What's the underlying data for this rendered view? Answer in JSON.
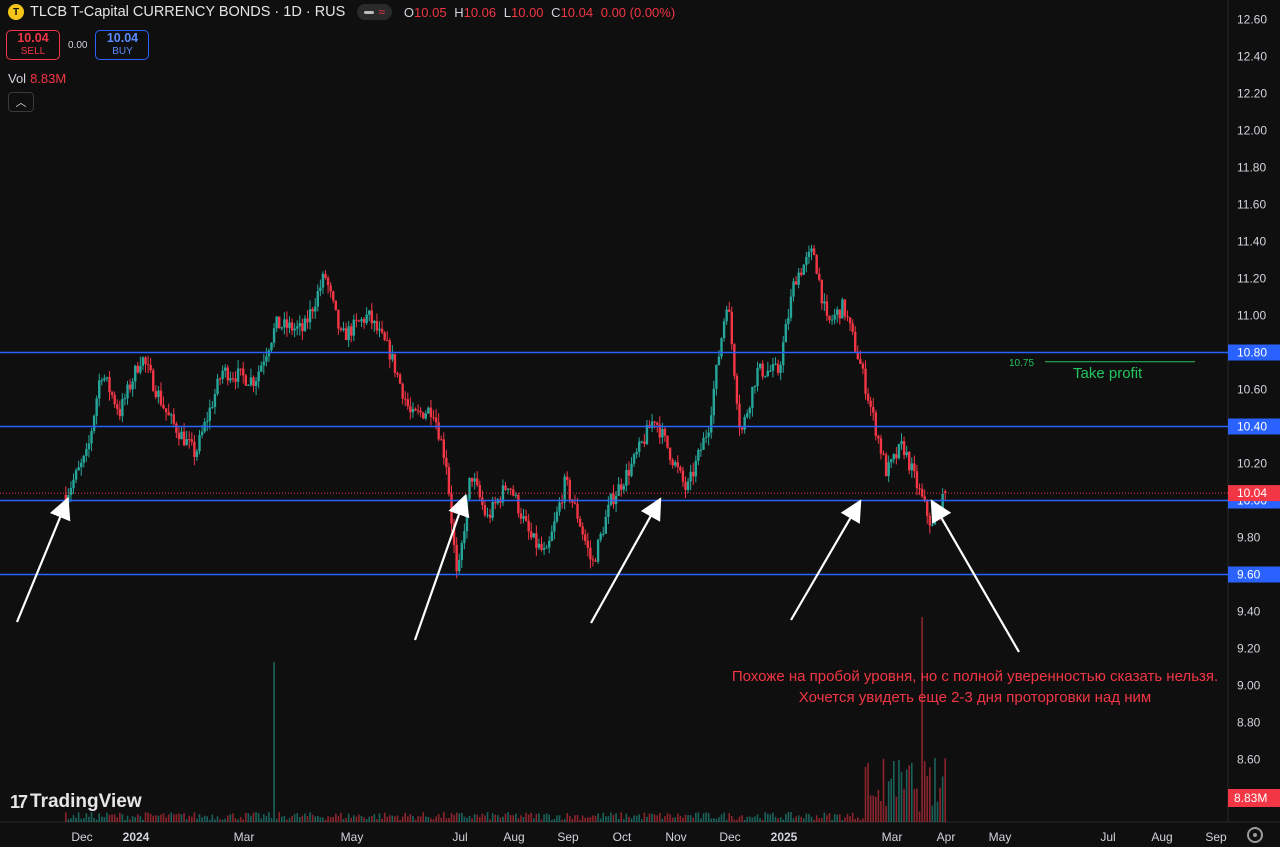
{
  "header": {
    "symbol_icon": "T",
    "title": "TLCB T-Capital CURRENCY BONDS · 1D · RUS",
    "o_label": "O",
    "o": "10.05",
    "h_label": "H",
    "h": "10.06",
    "l_label": "L",
    "l": "10.00",
    "c_label": "C",
    "c": "10.04",
    "change": "0.00 (0.00%)"
  },
  "trade": {
    "sell_price": "10.04",
    "sell_label": "SELL",
    "spread": "0.00",
    "buy_price": "10.04",
    "buy_label": "BUY"
  },
  "volume": {
    "label": "Vol",
    "value": "8.83M"
  },
  "logo_text": "TradingView",
  "colors": {
    "up": "#26a69a",
    "down": "#f23645",
    "level": "#2962ff",
    "target": "#22c55e",
    "bg": "#0f0f0f"
  },
  "chart_data": {
    "type": "candlestick",
    "ylim": [
      9.0,
      12.7
    ],
    "y_ticks": [
      "12.60",
      "12.40",
      "12.20",
      "12.00",
      "11.80",
      "11.60",
      "11.40",
      "11.20",
      "11.00",
      "10.80",
      "10.60",
      "10.40",
      "10.20",
      "10.00",
      "9.80",
      "9.60",
      "9.40",
      "9.20",
      "9.00",
      "8.80",
      "8.60"
    ],
    "x_ticks": [
      {
        "label": "Dec",
        "month": 0,
        "bold": false
      },
      {
        "label": "2024",
        "month": 1,
        "bold": true
      },
      {
        "label": "Mar",
        "month": 3,
        "bold": false
      },
      {
        "label": "May",
        "month": 5,
        "bold": false
      },
      {
        "label": "Jul",
        "month": 7,
        "bold": false
      },
      {
        "label": "Aug",
        "month": 8,
        "bold": false
      },
      {
        "label": "Sep",
        "month": 9,
        "bold": false
      },
      {
        "label": "Oct",
        "month": 10,
        "bold": false
      },
      {
        "label": "Nov",
        "month": 11,
        "bold": false
      },
      {
        "label": "Dec",
        "month": 12,
        "bold": false
      },
      {
        "label": "2025",
        "month": 13,
        "bold": true
      },
      {
        "label": "Mar",
        "month": 15,
        "bold": false
      },
      {
        "label": "Apr",
        "month": 16,
        "bold": false
      },
      {
        "label": "May",
        "month": 17,
        "bold": false
      },
      {
        "label": "Jul",
        "month": 19,
        "bold": false
      },
      {
        "label": "Aug",
        "month": 20,
        "bold": false
      },
      {
        "label": "Sep",
        "month": 21,
        "bold": false
      }
    ],
    "levels": [
      {
        "price": 10.8,
        "label": "10.80"
      },
      {
        "price": 10.4,
        "label": "10.40"
      },
      {
        "price": 10.0,
        "label": "10.00"
      },
      {
        "price": 9.6,
        "label": "9.60"
      }
    ],
    "current_price": {
      "price": 10.04,
      "label": "10.04"
    },
    "volume_label": "8.83M",
    "take_profit": {
      "price": 10.75,
      "label": "10.75",
      "text": "Take profit"
    },
    "anchors": [
      {
        "month": -0.3,
        "price": 10.03
      },
      {
        "month": 0.1,
        "price": 10.25
      },
      {
        "month": 0.35,
        "price": 10.7
      },
      {
        "month": 0.7,
        "price": 10.48
      },
      {
        "month": 1.1,
        "price": 10.78
      },
      {
        "month": 1.6,
        "price": 10.45
      },
      {
        "month": 2.1,
        "price": 10.25
      },
      {
        "month": 2.6,
        "price": 10.7
      },
      {
        "month": 3.2,
        "price": 10.65
      },
      {
        "month": 3.6,
        "price": 10.95
      },
      {
        "month": 4.1,
        "price": 10.92
      },
      {
        "month": 4.5,
        "price": 11.22
      },
      {
        "month": 4.8,
        "price": 10.88
      },
      {
        "month": 5.3,
        "price": 11.0
      },
      {
        "month": 5.7,
        "price": 10.8
      },
      {
        "month": 6.1,
        "price": 10.45
      },
      {
        "month": 6.5,
        "price": 10.5
      },
      {
        "month": 6.75,
        "price": 10.2
      },
      {
        "month": 6.95,
        "price": 9.55
      },
      {
        "month": 7.2,
        "price": 10.15
      },
      {
        "month": 7.5,
        "price": 9.9
      },
      {
        "month": 7.9,
        "price": 10.1
      },
      {
        "month": 8.3,
        "price": 9.8
      },
      {
        "month": 8.6,
        "price": 9.7
      },
      {
        "month": 8.95,
        "price": 10.1
      },
      {
        "month": 9.2,
        "price": 9.9
      },
      {
        "month": 9.45,
        "price": 9.65
      },
      {
        "month": 9.8,
        "price": 10.0
      },
      {
        "month": 10.2,
        "price": 10.2
      },
      {
        "month": 10.6,
        "price": 10.45
      },
      {
        "month": 10.9,
        "price": 10.25
      },
      {
        "month": 11.2,
        "price": 10.05
      },
      {
        "month": 11.6,
        "price": 10.4
      },
      {
        "month": 11.95,
        "price": 11.1
      },
      {
        "month": 12.2,
        "price": 10.35
      },
      {
        "month": 12.5,
        "price": 10.7
      },
      {
        "month": 12.9,
        "price": 10.7
      },
      {
        "month": 13.2,
        "price": 11.2
      },
      {
        "month": 13.55,
        "price": 11.35
      },
      {
        "month": 13.8,
        "price": 10.95
      },
      {
        "month": 14.1,
        "price": 11.05
      },
      {
        "month": 14.4,
        "price": 10.75
      },
      {
        "month": 14.65,
        "price": 10.45
      },
      {
        "month": 14.9,
        "price": 10.15
      },
      {
        "month": 15.2,
        "price": 10.3
      },
      {
        "month": 15.5,
        "price": 10.05
      },
      {
        "month": 15.75,
        "price": 9.85
      },
      {
        "month": 16.0,
        "price": 10.04
      }
    ]
  },
  "annotation": {
    "text": "Похоже на пробой уровня, но с полной уверенностью сказать нельзя. Хочется увидеть еще 2-3 дня проторговки над ним"
  }
}
